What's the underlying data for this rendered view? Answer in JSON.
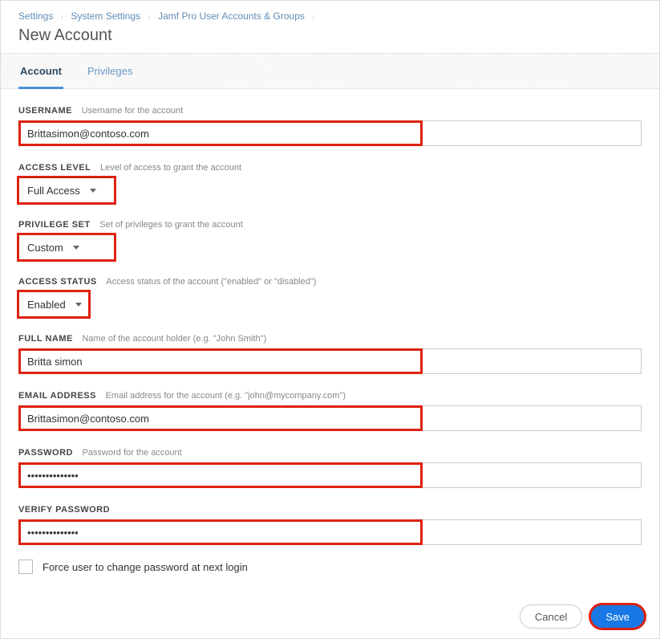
{
  "breadcrumb": {
    "a": "Settings",
    "b": "System Settings",
    "c": "Jamf Pro User Accounts & Groups"
  },
  "page_title": "New Account",
  "tabs": {
    "account": "Account",
    "privileges": "Privileges"
  },
  "fields": {
    "username": {
      "label": "USERNAME",
      "hint": "Username for the account",
      "value": "Brittasimon@contoso.com"
    },
    "access_level": {
      "label": "ACCESS LEVEL",
      "hint": "Level of access to grant the account",
      "value": "Full Access"
    },
    "privilege_set": {
      "label": "PRIVILEGE SET",
      "hint": "Set of privileges to grant the account",
      "value": "Custom"
    },
    "access_status": {
      "label": "ACCESS STATUS",
      "hint": "Access status of the account (\"enabled\" or \"disabled\")",
      "value": "Enabled"
    },
    "full_name": {
      "label": "FULL NAME",
      "hint": "Name of the account holder (e.g. \"John Smith\")",
      "value": "Britta simon"
    },
    "email": {
      "label": "EMAIL ADDRESS",
      "hint": "Email address for the account (e.g. \"john@mycompany.com\")",
      "value": "Brittasimon@contoso.com"
    },
    "password": {
      "label": "PASSWORD",
      "hint": "Password for the account",
      "value": "••••••••••••••"
    },
    "verify_password": {
      "label": "VERIFY PASSWORD",
      "hint": "",
      "value": "••••••••••••••"
    },
    "force_change": {
      "label": "Force user to change password at next login"
    }
  },
  "buttons": {
    "cancel": "Cancel",
    "save": "Save"
  }
}
